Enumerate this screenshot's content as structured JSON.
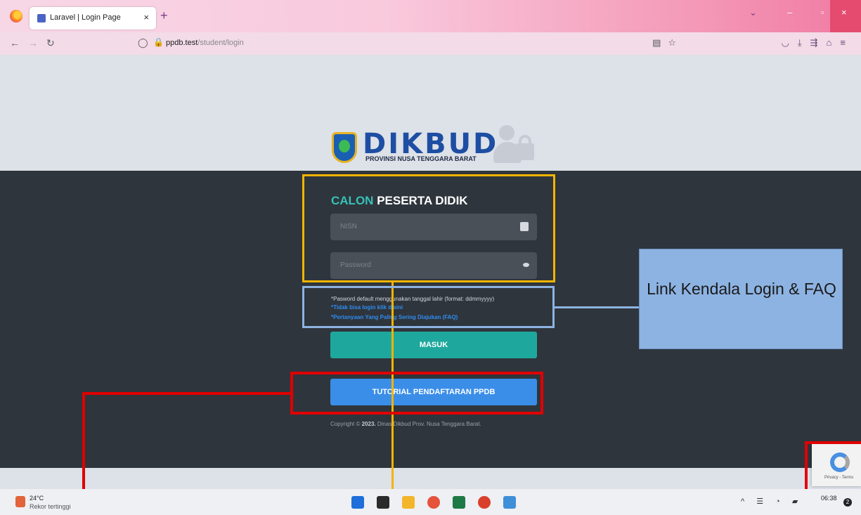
{
  "browser": {
    "tab_title": "Laravel | Login Page",
    "tab_close": "×",
    "new_tab": "+",
    "url_host": "ppdb.test",
    "url_path": "/student/login"
  },
  "logo": {
    "brand": "DIKBUD",
    "subtitle": "PROVINSI NUSA TENGGARA BARAT"
  },
  "form": {
    "title_accent": "CALON",
    "title_rest": "PESERTA DIDIK",
    "nisn_placeholder": "NISN",
    "password_placeholder": "Password",
    "password_note": "*Pasword default menggunakan tanggal lahir (format: ddmmyyyy)",
    "link_login_help": "*Tidak bisa login klik disini",
    "link_faq": "*Pertanyaan Yang Paling Sering Diajukan (FAQ)",
    "submit_label": "MASUK",
    "tutorial_label": "TUTORIAL PENDAFTARAN PPDB",
    "copyright_prefix": "Copyright ©",
    "copyright_year": "2023.",
    "copyright_rest": "Dinas Dikbud Prov. Nusa Tenggara Barat."
  },
  "annotation": {
    "callout_text": "Link Kendala Login & FAQ"
  },
  "recaptcha": {
    "text": "Privacy - Terms"
  },
  "taskbar": {
    "temperature": "24°C",
    "weather_desc": "Rekor tertinggi",
    "time": "06:38"
  },
  "colors": {
    "accent_teal": "#36c2b6",
    "button_teal": "#1ea89d",
    "button_blue": "#3b8ee8",
    "annotation_yellow": "#f3b400",
    "annotation_red": "#e00000",
    "annotation_blue": "#8db3e2"
  }
}
